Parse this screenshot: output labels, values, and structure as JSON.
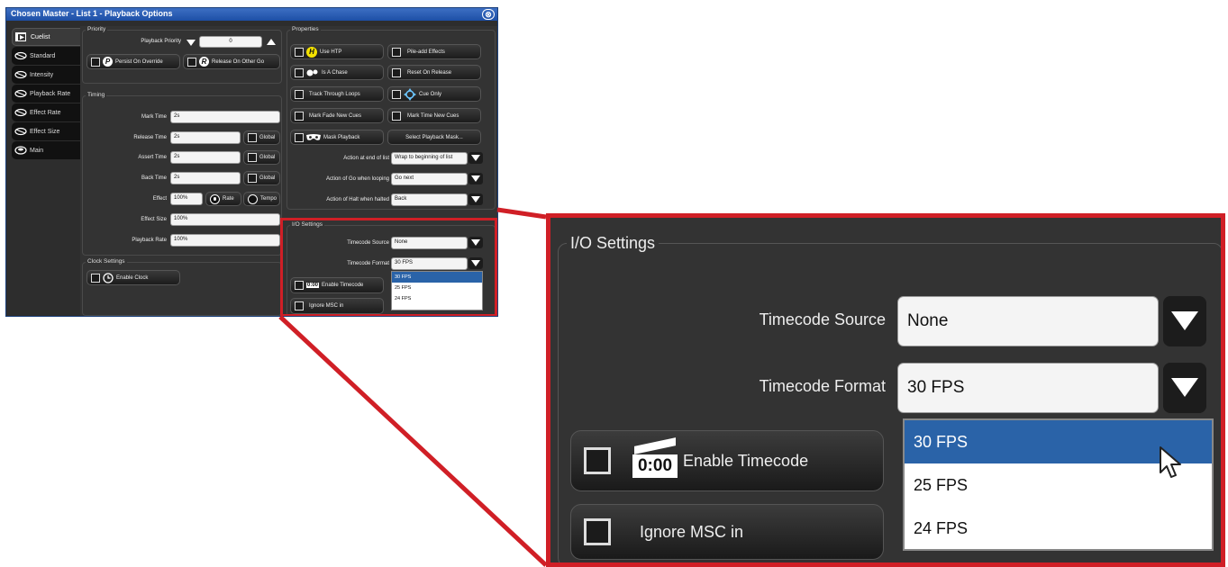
{
  "window": {
    "title": "Chosen Master - List 1 - Playback Options",
    "close_glyph": "⊗"
  },
  "tabs": [
    {
      "label": "Cuelist",
      "icon": "cuelist-icon",
      "active": true
    },
    {
      "label": "Standard",
      "icon": "fader-icon"
    },
    {
      "label": "Intensity",
      "icon": "fader-icon"
    },
    {
      "label": "Playback Rate",
      "icon": "fader-icon"
    },
    {
      "label": "Effect Rate",
      "icon": "fader-icon"
    },
    {
      "label": "Effect Size",
      "icon": "fader-icon"
    },
    {
      "label": "Main",
      "icon": "main-icon"
    }
  ],
  "priority": {
    "group_title": "Priority",
    "playback_priority_label": "Playback Priority",
    "playback_priority_value": "0",
    "persist_label": "Persist On Override",
    "release_label": "Release On Other Go",
    "persist_icon_glyph": "P",
    "release_icon_glyph": "R"
  },
  "timing": {
    "group_title": "Timing",
    "mark_time_label": "Mark Time",
    "mark_time_value": "2s",
    "release_time_label": "Release Time",
    "release_time_value": "2s",
    "assert_time_label": "Assert Time",
    "assert_time_value": "2s",
    "back_time_label": "Back Time",
    "back_time_value": "2s",
    "global_label": "Global",
    "effect_label": "Effect",
    "effect_value": "100%",
    "rate_label": "Rate",
    "tempo_label": "Tempo",
    "effect_size_label": "Effect Size",
    "effect_size_value": "100%",
    "playback_rate_label": "Playback Rate",
    "playback_rate_value": "100%"
  },
  "clock": {
    "group_title": "Clock Settings",
    "enable_clock_label": "Enable Clock"
  },
  "properties": {
    "group_title": "Properties",
    "use_htp": "Use HTP",
    "pile_add": "Pile-add Effects",
    "is_a_chase": "Is A Chase",
    "reset_on_release": "Reset On Release",
    "track_through_loops": "Track Through Loops",
    "cue_only": "Cue Only",
    "mark_fade_new_cues": "Mark Fade New Cues",
    "mark_time_new_cues": "Mark Time New Cues",
    "mask_playback": "Mask Playback",
    "select_playback_mask": "Select Playback Mask...",
    "action_end_label": "Action at end of list",
    "action_end_value": "Wrap to beginning of list",
    "action_go_label": "Action of Go when looping",
    "action_go_value": "Go next",
    "action_halt_label": "Action of Halt when halted",
    "action_halt_value": "Back",
    "htp_glyph": "H"
  },
  "io": {
    "group_title": "I/O Settings",
    "timecode_source_label": "Timecode Source",
    "timecode_source_value": "None",
    "timecode_format_label": "Timecode Format",
    "timecode_format_value": "30 FPS",
    "format_options": [
      "30 FPS",
      "25 FPS",
      "24 FPS"
    ],
    "enable_timecode_label": "Enable Timecode",
    "timecode_icon_text": "0:00",
    "ignore_msc_label": "Ignore MSC in"
  },
  "colors": {
    "accent_red": "#d01f26",
    "selected_blue": "#2a63a8",
    "titlebar_blue": "#2a5bb5"
  }
}
